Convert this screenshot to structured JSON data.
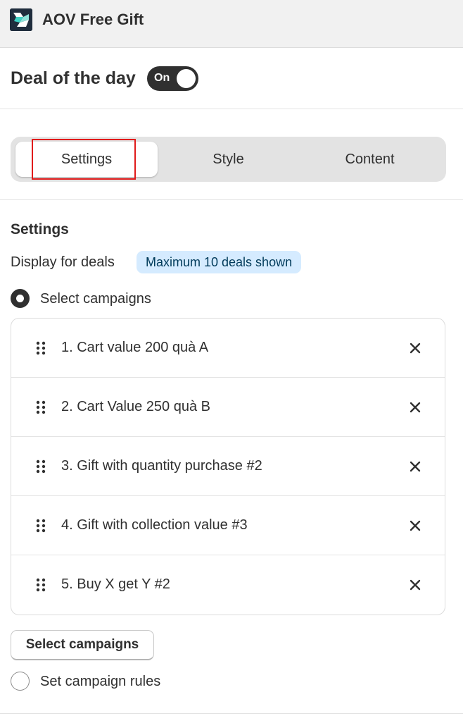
{
  "app": {
    "title": "AOV Free Gift",
    "logo_icon": "aov-free-gift-logo"
  },
  "header": {
    "title": "Deal of the day",
    "toggle_label": "On",
    "toggle_state": "on"
  },
  "tabs": [
    {
      "label": "Settings",
      "active": true
    },
    {
      "label": "Style",
      "active": false
    },
    {
      "label": "Content",
      "active": false
    }
  ],
  "settings": {
    "section_title": "Settings",
    "display_label": "Display for deals",
    "badge": "Maximum 10 deals shown",
    "option_select": "Select campaigns",
    "option_select_checked": true,
    "campaigns": [
      {
        "name": "1. Cart value 200 quà A"
      },
      {
        "name": "2. Cart Value 250 quà B"
      },
      {
        "name": "3. Gift with quantity purchase #2"
      },
      {
        "name": "4. Gift with collection value #3"
      },
      {
        "name": "5. Buy X get Y #2"
      }
    ],
    "select_button": "Select campaigns",
    "option_rules": "Set campaign rules",
    "option_rules_checked": false
  },
  "colors": {
    "highlight": "#e01b1b",
    "badge_bg": "#d5ebff",
    "toggle_bg": "#303030"
  }
}
